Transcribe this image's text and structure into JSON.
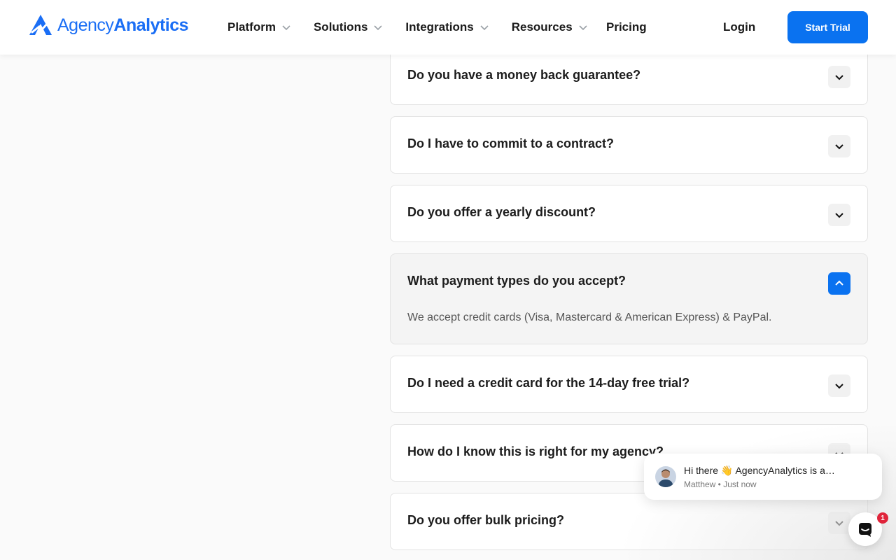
{
  "header": {
    "logo": {
      "part1": "Agency",
      "part2": "Analytics"
    },
    "nav": [
      {
        "label": "Platform"
      },
      {
        "label": "Solutions"
      },
      {
        "label": "Integrations"
      },
      {
        "label": "Resources"
      }
    ],
    "pricing_label": "Pricing",
    "login_label": "Login",
    "cta_label": "Start Trial",
    "accent_color": "#0a72f0"
  },
  "faq": [
    {
      "question": "Do you have a money back guarantee?",
      "expanded": false
    },
    {
      "question": "Do I have to commit to a contract?",
      "expanded": false
    },
    {
      "question": "Do you offer a yearly discount?",
      "expanded": false
    },
    {
      "question": "What payment types do you accept?",
      "expanded": true,
      "answer": "We accept credit cards (Visa, Mastercard & American Express) & PayPal."
    },
    {
      "question": "Do I need a credit card for the 14-day free trial?",
      "expanded": false
    },
    {
      "question": "How do I know this is right for my agency?",
      "expanded": false
    },
    {
      "question": "Do you offer bulk pricing?",
      "expanded": false
    }
  ],
  "chat": {
    "message": "Hi there 👋 AgencyAnalytics is a…",
    "sender": "Matthew",
    "time": "Just now",
    "meta": "Matthew • Just now",
    "unread_count": "1"
  }
}
